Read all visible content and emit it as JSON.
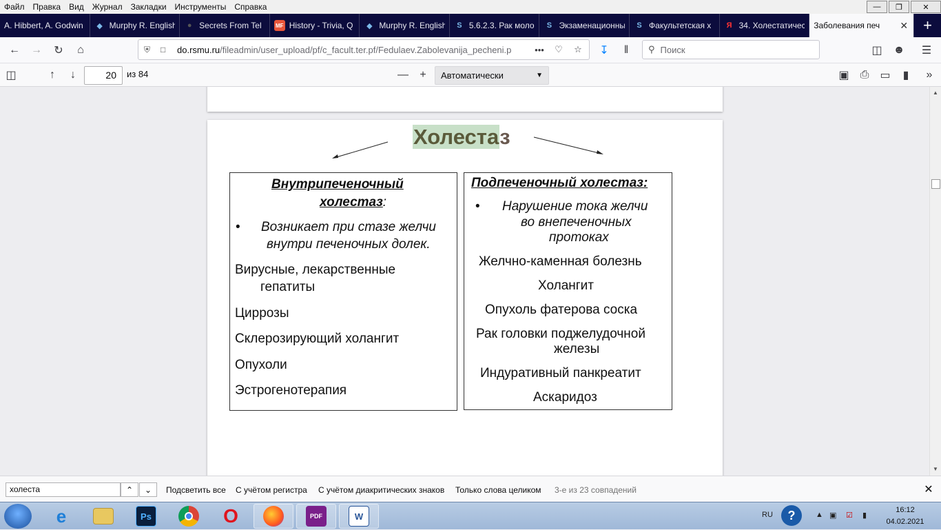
{
  "menu": [
    {
      "label": "Файл"
    },
    {
      "label": "Правка"
    },
    {
      "label": "Вид"
    },
    {
      "label": "Журнал"
    },
    {
      "label": "Закладки"
    },
    {
      "label": "Инструменты"
    },
    {
      "label": "Справка"
    }
  ],
  "tabs": [
    {
      "label": "A. Hibbert, A. Godwin"
    },
    {
      "label": "Murphy R. English"
    },
    {
      "label": "Secrets From Tel"
    },
    {
      "label": "History - Trivia, Q"
    },
    {
      "label": "Murphy R. English"
    },
    {
      "label": "5.6.2.3. Рак моло"
    },
    {
      "label": "Экзаменационны"
    },
    {
      "label": "Факультетская х"
    },
    {
      "label": "34. Холестатичес"
    }
  ],
  "active_tab": {
    "label": "Заболевания печ"
  },
  "nav": {
    "url_domain": "do.rsmu.ru",
    "url_path": "/fileadmin/user_upload/pf/c_facult.ter.pf/Fedulaev.Zabolevanija_pecheni.p",
    "more": "•••",
    "search_placeholder": "Поиск"
  },
  "pdf_toolbar": {
    "page_number": "20",
    "page_count": "из 84",
    "zoom": "Автоматически"
  },
  "slide": {
    "title_highlight": "Холеста",
    "title_rest": "з",
    "left": {
      "header1": "Внутрипеченочный",
      "header2": "холестаз",
      "header_colon": ":",
      "bullet": "•",
      "bullet_line1": "Возникает при стазе желчи",
      "bullet_line2": "внутри печеночных долек.",
      "items": [
        {
          "line1": "Вирусные, лекарственные",
          "line2": "гепатиты"
        },
        {
          "line1": "Циррозы"
        },
        {
          "line1": "Склерозирующий холангит"
        },
        {
          "line1": "Опухоли"
        },
        {
          "line1": "Эстрогенотерапия"
        }
      ]
    },
    "right": {
      "header": "Подпеченочный холестаз:",
      "bullet": "•",
      "bullet_line1": "Нарушение тока желчи",
      "bullet_line2": "во внепеченочных",
      "bullet_line3": "протоках",
      "items": [
        {
          "line1": "Желчно-каменная болезнь"
        },
        {
          "line1": "Холангит"
        },
        {
          "line1": "Опухоль фатерова соска"
        },
        {
          "line1": "Рак головки поджелудочной",
          "line2": "железы"
        },
        {
          "line1": "Индуративный панкреатит"
        },
        {
          "line1": "Аскаридоз"
        }
      ]
    }
  },
  "findbar": {
    "query": "холеста",
    "highlight_all": "Подсветить все",
    "match_case": "С учётом регистра",
    "match_diacritics": "С учётом диакритических знаков",
    "whole_words": "Только слова целиком",
    "status": "3-е из 23 совпадений"
  },
  "taskbar": {
    "lang": "RU",
    "time": "16:12",
    "date": "04.02.2021"
  },
  "colors": {
    "tabbar_bg": "#0c0c3d",
    "title_highlight": "#c8e0c8",
    "accent_blue": "#0a84ff"
  }
}
